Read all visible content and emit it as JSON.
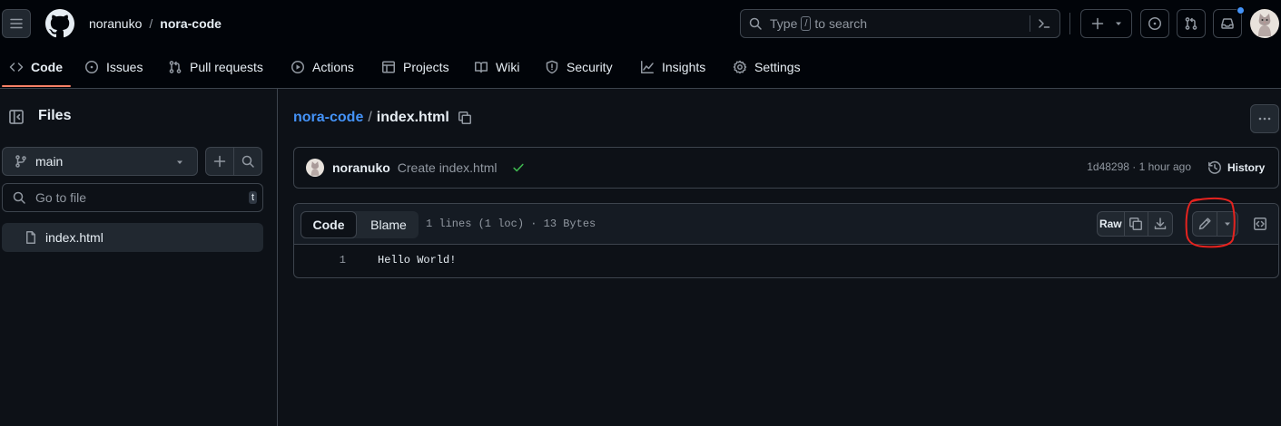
{
  "header": {
    "owner": "noranuko",
    "separator": "/",
    "repo": "nora-code",
    "search_placeholder": "Type / to search",
    "search_prefix": "Type",
    "search_key": "/",
    "search_suffix": "to search"
  },
  "repo_nav": [
    {
      "label": "Code",
      "icon": "code-icon",
      "active": true
    },
    {
      "label": "Issues",
      "icon": "issue-icon"
    },
    {
      "label": "Pull requests",
      "icon": "pull-request-icon"
    },
    {
      "label": "Actions",
      "icon": "play-icon"
    },
    {
      "label": "Projects",
      "icon": "table-icon"
    },
    {
      "label": "Wiki",
      "icon": "book-icon"
    },
    {
      "label": "Security",
      "icon": "shield-icon"
    },
    {
      "label": "Insights",
      "icon": "graph-icon"
    },
    {
      "label": "Settings",
      "icon": "gear-icon"
    }
  ],
  "sidebar": {
    "title": "Files",
    "branch": "main",
    "goto_placeholder": "Go to file",
    "goto_shortcut": "t",
    "files": [
      {
        "name": "index.html",
        "icon": "file-icon"
      }
    ]
  },
  "breadcrumb": {
    "repo": "nora-code",
    "separator": "/",
    "file": "index.html"
  },
  "commit": {
    "author": "noranuko",
    "message": "Create index.html",
    "status": "success",
    "sha_time": "1d48298 · 1 hour ago",
    "history_label": "History"
  },
  "file_view": {
    "tabs": [
      "Code",
      "Blame"
    ],
    "active_tab": "Code",
    "meta": "1 lines (1 loc) · 13 Bytes",
    "raw_label": "Raw",
    "lines": [
      {
        "number": "1",
        "text": "Hello World!"
      }
    ]
  },
  "colors": {
    "background": "#0d1117",
    "header_bg": "#010409",
    "border": "#3d444d",
    "link": "#4493f8",
    "active_underline": "#f78166",
    "success": "#3fb950",
    "annotation": "#e5231f",
    "notification_dot": "#4493f8"
  }
}
